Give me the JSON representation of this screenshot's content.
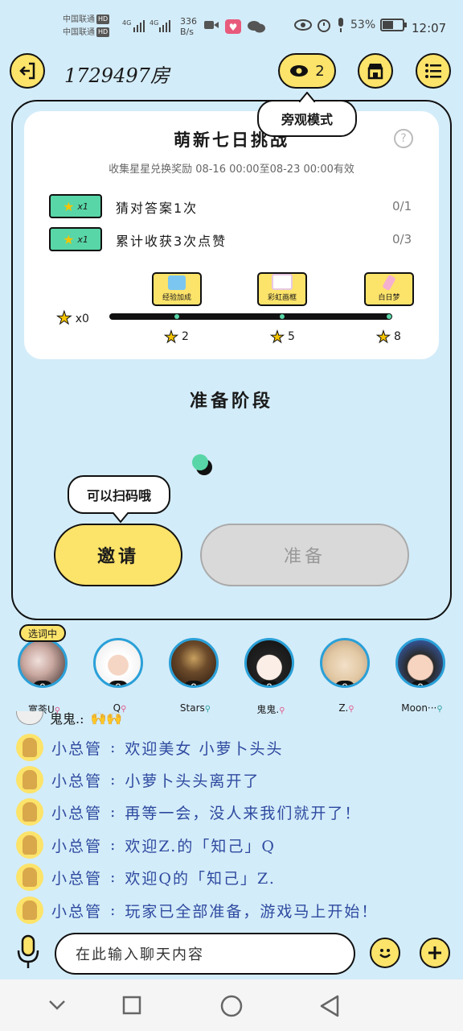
{
  "status": {
    "carrier1": "中国联通",
    "carrier2": "中国联通",
    "hd": "HD",
    "net": "4G",
    "speed_value": "336",
    "speed_unit": "B/s",
    "battery": "53%",
    "time": "12:07"
  },
  "header": {
    "room_title": "1729497房",
    "viewer_count": "2",
    "spectate_tooltip": "旁观模式"
  },
  "task_card": {
    "title": "萌新七日挑战",
    "subtitle": "收集星星兑换奖励 08-16 00:00至08-23 00:00有效",
    "help": "?",
    "tasks": [
      {
        "badge": "x1",
        "text": "猜对答案1次",
        "progress": "0/1"
      },
      {
        "badge": "x1",
        "text": "累计收获3次点赞",
        "progress": "0/3"
      }
    ],
    "start_label": "x0",
    "milestones": [
      {
        "reward": "经验加成",
        "stars": "2"
      },
      {
        "reward": "彩虹画框",
        "stars": "5"
      },
      {
        "reward": "白日梦",
        "stars": "8"
      }
    ]
  },
  "stage": "准备阶段",
  "scan_tooltip": "可以扫码哦",
  "buttons": {
    "invite": "邀请",
    "ready": "准备"
  },
  "choosing_badge": "选词中",
  "players": [
    {
      "name": "寞荼U",
      "score": "0"
    },
    {
      "name": "Q",
      "score": "0"
    },
    {
      "name": "Stars",
      "score": "0"
    },
    {
      "name": "鬼鬼.",
      "score": "0"
    },
    {
      "name": "Z.",
      "score": "0"
    },
    {
      "name": "Moon···",
      "score": "0"
    }
  ],
  "chat_partial": "鬼鬼.:",
  "chat": [
    {
      "sender": "小总管",
      "text": "欢迎美女 小萝卜头头"
    },
    {
      "sender": "小总管",
      "text": "小萝卜头头离开了"
    },
    {
      "sender": "小总管",
      "text": "再等一会，没人来我们就开了！"
    },
    {
      "sender": "小总管",
      "text": "欢迎Z.的「知己」Q"
    },
    {
      "sender": "小总管",
      "text": "欢迎Q的「知己」Z."
    },
    {
      "sender": "小总管",
      "text": "玩家已全部准备，游戏马上开始！"
    }
  ],
  "input": {
    "placeholder": "在此输入聊天内容"
  },
  "colors": {
    "accent": "#fce36a",
    "teal": "#58d6a7",
    "bg": "#d3ecf9"
  }
}
